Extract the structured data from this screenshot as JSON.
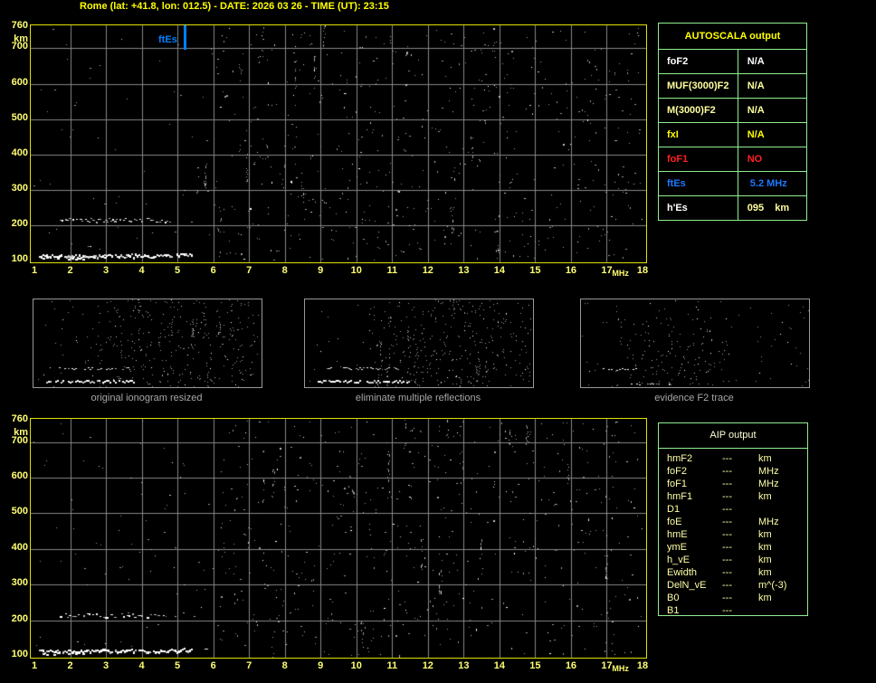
{
  "title": "Rome (lat: +41.8, lon: 012.5) - DATE: 2026 03 26 - TIME (UT): 23:15",
  "colors": {
    "title_yellow": "#ffff00",
    "axis_yellow": "#ffff73",
    "plot_border_yellow": "#e0e000",
    "grid_gray": "#878787",
    "table_green": "#90ee90",
    "marker_blue": "#0080ff",
    "alert_red": "#ff2020",
    "pale_yellow": "#ffff9e",
    "white": "#ffffff",
    "caption_gray": "#a8a8a8"
  },
  "axes": {
    "x_ticks": [
      "1",
      "2",
      "3",
      "4",
      "5",
      "6",
      "7",
      "8",
      "9",
      "10",
      "11",
      "12",
      "13",
      "14",
      "15",
      "16",
      "17",
      "18"
    ],
    "x_unit": "MHz",
    "y_ticks": [
      "760",
      "700",
      "600",
      "500",
      "400",
      "300",
      "200",
      "100"
    ],
    "y_unit": "km"
  },
  "ftes_marker": {
    "label": "ftEs",
    "freq_mhz": 5.2
  },
  "autoscala_table": {
    "title": "AUTOSCALA output",
    "rows": [
      {
        "param": "foF2",
        "value": "N/A",
        "param_color": "#ffffff",
        "value_color": "#ffffff"
      },
      {
        "param": "MUF(3000)F2",
        "value": "N/A",
        "param_color": "#ffff9e",
        "value_color": "#ffff9e"
      },
      {
        "param": "M(3000)F2",
        "value": "N/A",
        "param_color": "#ffff9e",
        "value_color": "#ffff9e"
      },
      {
        "param": "fxI",
        "value": "N/A",
        "param_color": "#ffff00",
        "value_color": "#ffff00"
      },
      {
        "param": "foF1",
        "value": "NO",
        "param_color": "#ff2020",
        "value_color": "#ff2020"
      },
      {
        "param": "ftEs",
        "value": " 5.2 MHz",
        "param_color": "#1e78ff",
        "value_color": "#1e78ff"
      },
      {
        "param": "h'Es",
        "value": "095    km",
        "param_color": "#ffffff",
        "value_color": "#ffff9e"
      }
    ]
  },
  "thumbnails": [
    {
      "caption": "original ionogram resized"
    },
    {
      "caption": "eliminate multiple reflections"
    },
    {
      "caption": "evidence F2 trace"
    }
  ],
  "aip_table": {
    "title": "AIP output",
    "rows": [
      {
        "param": "hmF2",
        "value": "---",
        "unit": "km"
      },
      {
        "param": "foF2",
        "value": "---",
        "unit": "MHz"
      },
      {
        "param": "foF1",
        "value": "---",
        "unit": "MHz"
      },
      {
        "param": "hmF1",
        "value": "---",
        "unit": "km"
      },
      {
        "param": "D1",
        "value": "---",
        "unit": ""
      },
      {
        "param": "foE",
        "value": "---",
        "unit": "MHz"
      },
      {
        "param": "hmE",
        "value": "---",
        "unit": "km"
      },
      {
        "param": "ymE",
        "value": "---",
        "unit": "km"
      },
      {
        "param": "h_vE",
        "value": "---",
        "unit": "km"
      },
      {
        "param": "Ewidth",
        "value": "---",
        "unit": "km"
      },
      {
        "param": "DelN_vE",
        "value": "---",
        "unit": "m^(-3)"
      },
      {
        "param": "B0",
        "value": "---",
        "unit": "km"
      },
      {
        "param": "B1",
        "value": "---",
        "unit": ""
      }
    ]
  },
  "chart_data": {
    "type": "scatter",
    "title": "Ionogram - Rome, 2026 03 26, 23:15 UT",
    "xlabel": "MHz",
    "ylabel": "km",
    "xlim": [
      1,
      18
    ],
    "ylim": [
      100,
      760
    ],
    "grid": true,
    "series": [
      {
        "name": "sporadic-E trace (first reflection)",
        "height_km": 110,
        "x_range_mhz": [
          1.1,
          5.4
        ],
        "style": "dense white trace"
      },
      {
        "name": "sporadic-E trace (second reflection)",
        "height_km": 220,
        "x_range_mhz": [
          1.6,
          4.8
        ],
        "style": "weaker scattered trace"
      },
      {
        "name": "background noise echoes",
        "style": "sparse gray dots over full plot, denser on right half"
      }
    ],
    "annotations": [
      {
        "label": "ftEs",
        "freq_mhz": 5.2,
        "color": "#0080ff"
      }
    ]
  }
}
